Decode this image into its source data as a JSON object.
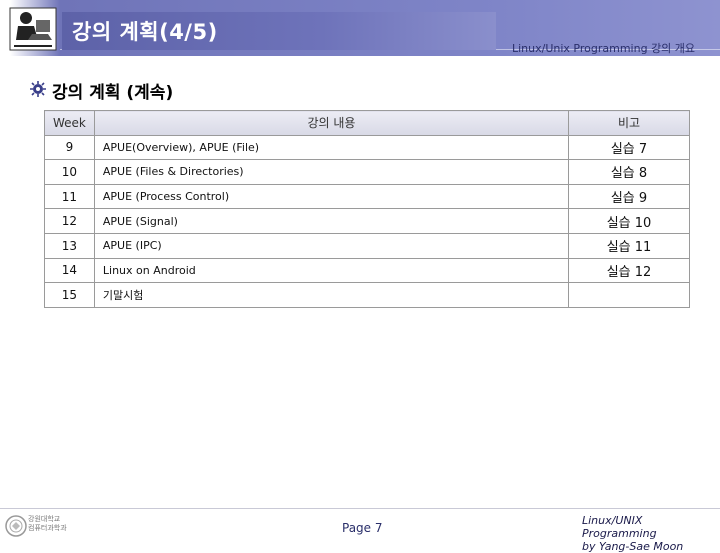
{
  "header": {
    "title": "강의 계획(4/5)",
    "subtitle": "Linux/Unix Programming 강의 개요"
  },
  "section": {
    "title": "강의 계획 (계속)"
  },
  "table": {
    "columns": [
      "Week",
      "강의 내용",
      "비고"
    ],
    "rows": [
      {
        "week": "9",
        "content": "APUE(Overview), APUE (File)",
        "note": "실습 7"
      },
      {
        "week": "10",
        "content": "APUE (Files & Directories)",
        "note": "실습 8"
      },
      {
        "week": "11",
        "content": "APUE (Process Control)",
        "note": "실습 9"
      },
      {
        "week": "12",
        "content": "APUE (Signal)",
        "note": "실습 10"
      },
      {
        "week": "13",
        "content": "APUE (IPC)",
        "note": "실습 11"
      },
      {
        "week": "14",
        "content": "Linux on Android",
        "note": "실습 12"
      },
      {
        "week": "15",
        "content": "기말시험",
        "note": ""
      }
    ]
  },
  "footer": {
    "page": "Page 7",
    "credit_line1": "Linux/UNIX Programming",
    "credit_line2": "by Yang-Sae Moon",
    "logo_text_line1": "강원대학교",
    "logo_text_line2": "컴퓨터과학과"
  },
  "icons": {
    "header_logo": "person-at-computer-icon",
    "bullet": "gear-bullet-icon",
    "footer_logo": "university-seal-icon"
  },
  "colors": {
    "header_band": "#7f85c8",
    "title_box": "#5d62a8",
    "title_text": "#ffffff",
    "subtitle_text": "#2a2f6a",
    "table_header": "#d8d9e6",
    "table_border": "#9a9a9a"
  }
}
